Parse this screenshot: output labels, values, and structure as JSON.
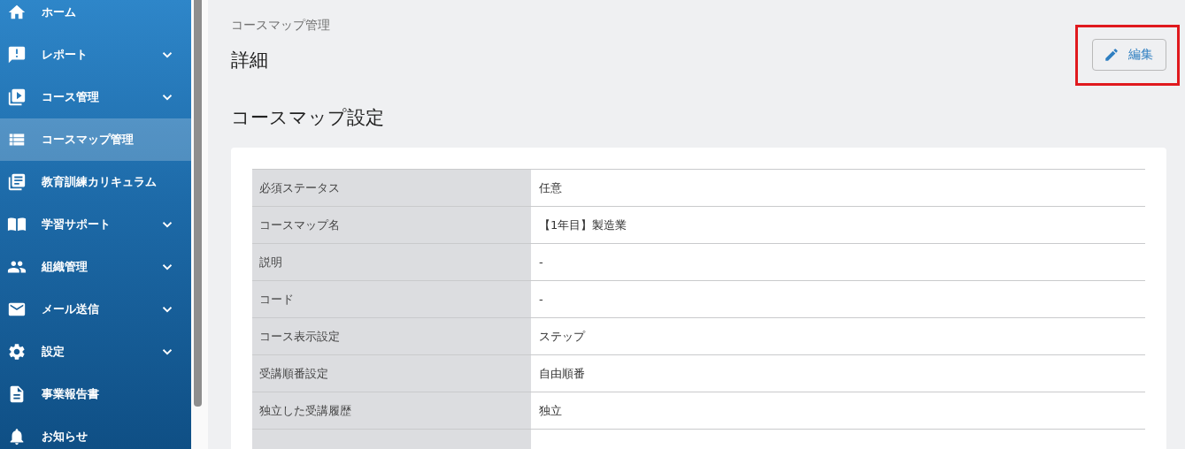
{
  "sidebar": {
    "items": [
      {
        "label": "ホーム",
        "expandable": false,
        "selected": false
      },
      {
        "label": "レポート",
        "expandable": true,
        "selected": false
      },
      {
        "label": "コース管理",
        "expandable": true,
        "selected": false
      },
      {
        "label": "コースマップ管理",
        "expandable": false,
        "selected": true
      },
      {
        "label": "教育訓練カリキュラム",
        "expandable": false,
        "selected": false
      },
      {
        "label": "学習サポート",
        "expandable": true,
        "selected": false
      },
      {
        "label": "組織管理",
        "expandable": true,
        "selected": false
      },
      {
        "label": "メール送信",
        "expandable": true,
        "selected": false
      },
      {
        "label": "設定",
        "expandable": true,
        "selected": false
      },
      {
        "label": "事業報告書",
        "expandable": false,
        "selected": false
      },
      {
        "label": "お知らせ",
        "expandable": false,
        "selected": false
      }
    ]
  },
  "breadcrumb": "コースマップ管理",
  "page_title": "詳細",
  "edit_button": "編集",
  "section_title": "コースマップ設定",
  "table": {
    "rows": [
      {
        "label": "必須ステータス",
        "value": "任意"
      },
      {
        "label": "コースマップ名",
        "value": "【1年目】製造業"
      },
      {
        "label": "説明",
        "value": "-"
      },
      {
        "label": "コード",
        "value": "-"
      },
      {
        "label": "コース表示設定",
        "value": "ステップ"
      },
      {
        "label": "受講順番設定",
        "value": "自由順番"
      },
      {
        "label": "独立した受講履歴",
        "value": "独立"
      }
    ]
  }
}
